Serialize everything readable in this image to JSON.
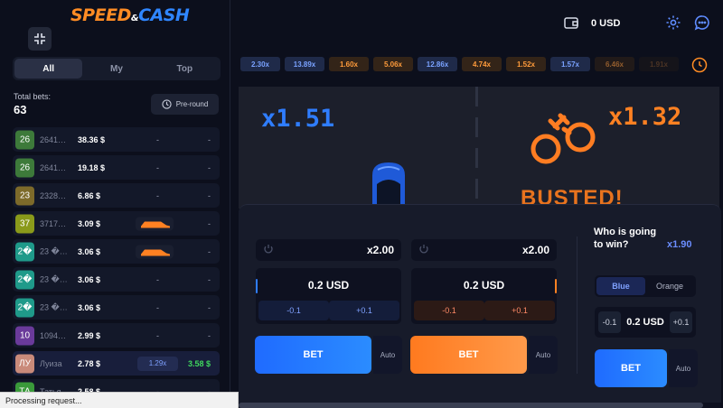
{
  "logo": {
    "part1": "SPEED",
    "part2": "&",
    "part3": "CASH"
  },
  "filter_tabs": [
    "All",
    "My",
    "Top"
  ],
  "total_bets": {
    "label": "Total bets:",
    "value": "63"
  },
  "preround_label": "Pre-round",
  "bets": [
    {
      "avatar": "26",
      "color": "#3d7a3a",
      "user": "2641…",
      "amount": "38.36 $",
      "mult": "-",
      "win": "-"
    },
    {
      "avatar": "26",
      "color": "#3d7a3a",
      "user": "2641…",
      "amount": "19.18 $",
      "mult": "-",
      "win": "-"
    },
    {
      "avatar": "23",
      "color": "#7d6a2a",
      "user": "2328…",
      "amount": "6.86 $",
      "mult": "-",
      "win": "-"
    },
    {
      "avatar": "37",
      "color": "#8a9a1a",
      "user": "3717…",
      "amount": "3.09 $",
      "mult": "",
      "win": "-",
      "car": true
    },
    {
      "avatar": "2�",
      "color": "#1f9a8a",
      "user": "23 �…",
      "amount": "3.06 $",
      "mult": "",
      "win": "-",
      "car": true
    },
    {
      "avatar": "2�",
      "color": "#1f9a8a",
      "user": "23 �…",
      "amount": "3.06 $",
      "mult": "-",
      "win": "-"
    },
    {
      "avatar": "2�",
      "color": "#1f9a8a",
      "user": "23 �…",
      "amount": "3.06 $",
      "mult": "-",
      "win": "-"
    },
    {
      "avatar": "10",
      "color": "#6a3a9a",
      "user": "1094…",
      "amount": "2.99 $",
      "mult": "-",
      "win": "-"
    },
    {
      "avatar": "ЛУ",
      "color": "#c98a7a",
      "user": "Луиза",
      "amount": "2.78 $",
      "mult": "1.29x",
      "win": "3.58 $",
      "highlight": true
    },
    {
      "avatar": "ТА",
      "color": "#3a9a3a",
      "user": "Татья…",
      "amount": "2.58 $",
      "mult": "-",
      "win": "-"
    }
  ],
  "status_text": "Processing request...",
  "balance": "0 USD",
  "history": [
    {
      "v": "2.30x",
      "c": "blue"
    },
    {
      "v": "13.89x",
      "c": "blue"
    },
    {
      "v": "1.60x",
      "c": "orange"
    },
    {
      "v": "5.06x",
      "c": "orange"
    },
    {
      "v": "12.86x",
      "c": "blue"
    },
    {
      "v": "4.74x",
      "c": "orange"
    },
    {
      "v": "1.52x",
      "c": "orange"
    },
    {
      "v": "1.57x",
      "c": "blue"
    },
    {
      "v": "6.46x",
      "c": "orange",
      "fade": 1
    },
    {
      "v": "1.91x",
      "c": "orange",
      "fade": 2
    }
  ],
  "game": {
    "blue_mult": "x1.51",
    "orange_mult": "x1.32",
    "busted": "BUSTED!"
  },
  "left_bet": {
    "auto_mult": "x2.00",
    "stake": "0.2 USD",
    "minus": "-0.1",
    "plus": "+0.1",
    "bet": "BET",
    "auto": "Auto"
  },
  "right_bet": {
    "auto_mult": "x2.00",
    "stake": "0.2 USD",
    "minus": "-0.1",
    "plus": "+0.1",
    "bet": "BET",
    "auto": "Auto"
  },
  "side_bet": {
    "title": "Who is going to win?",
    "mult": "x1.90",
    "blue": "Blue",
    "orange": "Orange",
    "stake": "0.2 USD",
    "minus": "-0.1",
    "plus": "+0.1",
    "bet": "BET",
    "auto": "Auto"
  },
  "colors": {
    "blue": "#2f7dff",
    "orange": "#ff8122",
    "bg": "#0c0f1c"
  },
  "icons": [
    "collapse-icon",
    "clock-icon",
    "wallet-icon",
    "gear-icon",
    "chat-icon",
    "power-icon",
    "handcuffs-icon"
  ]
}
